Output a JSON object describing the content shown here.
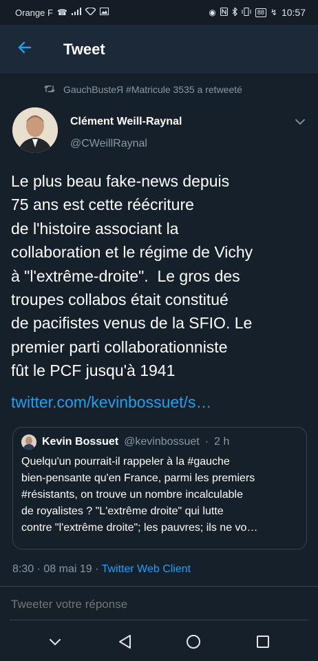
{
  "status_bar": {
    "carrier": "Orange F",
    "battery": "88",
    "time": "10:57",
    "icons": [
      "call-icon",
      "signal-icon",
      "wifi-icon",
      "image-icon",
      "eye-icon",
      "nfc-icon",
      "bluetooth-icon",
      "vibrate-icon",
      "battery-icon",
      "charging-icon"
    ]
  },
  "header": {
    "title": "Tweet",
    "back_icon": "arrow-left-icon"
  },
  "retweet": {
    "icon": "retweet-icon",
    "text": "GauchBusteЯ #Matricule 3535 a retweeté"
  },
  "author": {
    "name": "Clément Weill-Raynal",
    "handle": "@CWeillRaynal",
    "menu_icon": "chevron-down-icon"
  },
  "tweet": {
    "text": "Le plus beau fake-news depuis\n75 ans est cette réécriture\nde l'histoire associant la\ncollaboration et le régime de Vichy\nà \"l'extrême-droite\".  Le gros des\ntroupes collabos était constitué\nde pacifistes venus de la SFIO. Le\npremier parti collaborationniste\nfût le PCF jusqu'à 1941",
    "link": "twitter.com/kevinbossuet/s…"
  },
  "quoted_tweet": {
    "name": "Kevin Bossuet",
    "handle": "@kevinbossuet",
    "separator": "·",
    "time": "2 h",
    "text": "Quelqu'un pourrait-il rappeler à la #gauche\nbien-pensante qu'en France, parmi les premiers\n#résistants, on trouve un nombre incalculable\nde royalistes ? \"L'extrême droite\" qui lutte\ncontre \"l'extrême droite\"; les pauvres; ils ne vo…"
  },
  "meta": {
    "time": "8:30",
    "separator": "·",
    "date": "08 mai 19",
    "client": "Twitter Web Client"
  },
  "reply": {
    "placeholder": "Tweeter votre réponse"
  },
  "navigation": {
    "icons": [
      "nav-collapse-icon",
      "nav-back-icon",
      "nav-home-icon",
      "nav-recents-icon"
    ]
  },
  "colors": {
    "background": "#15202b",
    "header": "#1c2938",
    "accent": "#1da1f2",
    "secondary_text": "#8899a6",
    "border": "#38444d"
  }
}
